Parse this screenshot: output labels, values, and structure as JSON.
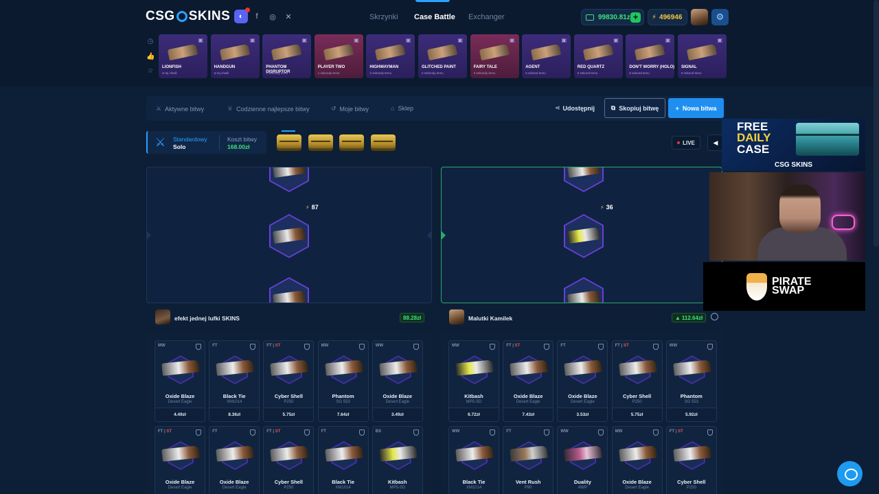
{
  "header": {
    "logo_left": "CSG",
    "logo_right": "SKINS",
    "nav": [
      "Skrzynki",
      "Case Battle",
      "Exchanger"
    ],
    "active_nav": "Case Battle",
    "balance": "99830.81zł",
    "coins": "496946"
  },
  "recent_drops": [
    {
      "name": "LIONFISH",
      "sub": "w tej chwili"
    },
    {
      "name": "HANDGUN",
      "sub": "w tej chwili"
    },
    {
      "name": "PHANTOM DISRUPTOR",
      "sub": "1 sekundy temu"
    },
    {
      "name": "PLAYER TWO",
      "sub": "1 sekundy temu"
    },
    {
      "name": "HIGHWAYMAN",
      "sub": "2 sekundy temu"
    },
    {
      "name": "GLITCHED PAINT",
      "sub": "2 sekundy temu"
    },
    {
      "name": "FAIRY TALE",
      "sub": "2 sekundy temu"
    },
    {
      "name": "AGENT",
      "sub": "6 sekund temu"
    },
    {
      "name": "RED QUARTZ",
      "sub": "6 sekund temu"
    },
    {
      "name": "DON'T WORRY (HOLO)",
      "sub": "6 sekund temu"
    },
    {
      "name": "SIGNAL",
      "sub": "6 sekund temu"
    }
  ],
  "battle_nav": {
    "tabs": [
      "Aktywne bitwy",
      "Codzienne najlepsze bitwy",
      "Moje bitwy",
      "Sklep"
    ],
    "share": "Udostępnij",
    "copy": "Skopiuj bitwę",
    "new": "Nowa bitwa"
  },
  "mode": {
    "type": "Standardowy",
    "variant": "Solo",
    "cost_label": "Koszt bitwy",
    "cost": "168.00zł"
  },
  "live_label": "LIVE",
  "rolls": {
    "left": "87",
    "right": "36"
  },
  "players": [
    {
      "name": "efekt jednej lufki SKINS",
      "value": "88.28zł",
      "items": [
        {
          "cond": "MW",
          "st": false,
          "name": "Oxide Blaze",
          "skin": "Desert Eagle",
          "price": "4.49zł"
        },
        {
          "cond": "FT",
          "st": false,
          "name": "Black Tie",
          "skin": "XM1014",
          "price": "8.36zł"
        },
        {
          "cond": "FT",
          "st": true,
          "name": "Cyber Shell",
          "skin": "P250",
          "price": "5.75zł"
        },
        {
          "cond": "MW",
          "st": false,
          "name": "Phantom",
          "skin": "SG 553",
          "price": "7.64zł"
        },
        {
          "cond": "WW",
          "st": false,
          "name": "Oxide Blaze",
          "skin": "Desert Eagle",
          "price": "3.49zł"
        },
        {
          "cond": "FT",
          "st": true,
          "name": "Oxide Blaze",
          "skin": "Desert Eagle",
          "price": ""
        },
        {
          "cond": "FT",
          "st": false,
          "name": "Oxide Blaze",
          "skin": "Desert Eagle",
          "price": ""
        },
        {
          "cond": "FT",
          "st": true,
          "name": "Cyber Shell",
          "skin": "P250",
          "price": ""
        },
        {
          "cond": "FT",
          "st": false,
          "name": "Black Tie",
          "skin": "XM1014",
          "price": ""
        },
        {
          "cond": "BS",
          "st": false,
          "name": "Kitbash",
          "skin": "MP5-SD",
          "price": ""
        }
      ]
    },
    {
      "name": "Malutki Kamilek",
      "value": "112.64zł",
      "items": [
        {
          "cond": "MW",
          "st": false,
          "name": "Kitbash",
          "skin": "MP5-SD",
          "price": "6.72zł"
        },
        {
          "cond": "FT",
          "st": true,
          "name": "Oxide Blaze",
          "skin": "Desert Eagle",
          "price": "7.43zł"
        },
        {
          "cond": "FT",
          "st": false,
          "name": "Oxide Blaze",
          "skin": "Desert Eagle",
          "price": "3.53zł"
        },
        {
          "cond": "FT",
          "st": true,
          "name": "Cyber Shell",
          "skin": "P250",
          "price": "5.75zł"
        },
        {
          "cond": "WW",
          "st": false,
          "name": "Phantom",
          "skin": "SG 553",
          "price": "5.92zł"
        },
        {
          "cond": "WW",
          "st": false,
          "name": "Black Tie",
          "skin": "XM1014",
          "price": ""
        },
        {
          "cond": "FT",
          "st": false,
          "name": "Vent Rush",
          "skin": "P90",
          "price": ""
        },
        {
          "cond": "WW",
          "st": false,
          "name": "Duality",
          "skin": "AWP",
          "price": ""
        },
        {
          "cond": "MW",
          "st": false,
          "name": "Oxide Blaze",
          "skin": "Desert Eagle",
          "price": ""
        },
        {
          "cond": "FT",
          "st": true,
          "name": "Cyber Shell",
          "skin": "P250",
          "price": ""
        }
      ]
    }
  ],
  "ad": {
    "line1": "FREE",
    "line2": "DAILY",
    "line3": "CASE",
    "brand": "CSG SKINS"
  },
  "sponsor": {
    "line1": "PIRATE",
    "line2": "SWAP"
  },
  "colors": {
    "accent": "#29a3ff",
    "positive": "#3ee07a",
    "gold": "#f6c343",
    "stattrak": "#e0564b"
  }
}
